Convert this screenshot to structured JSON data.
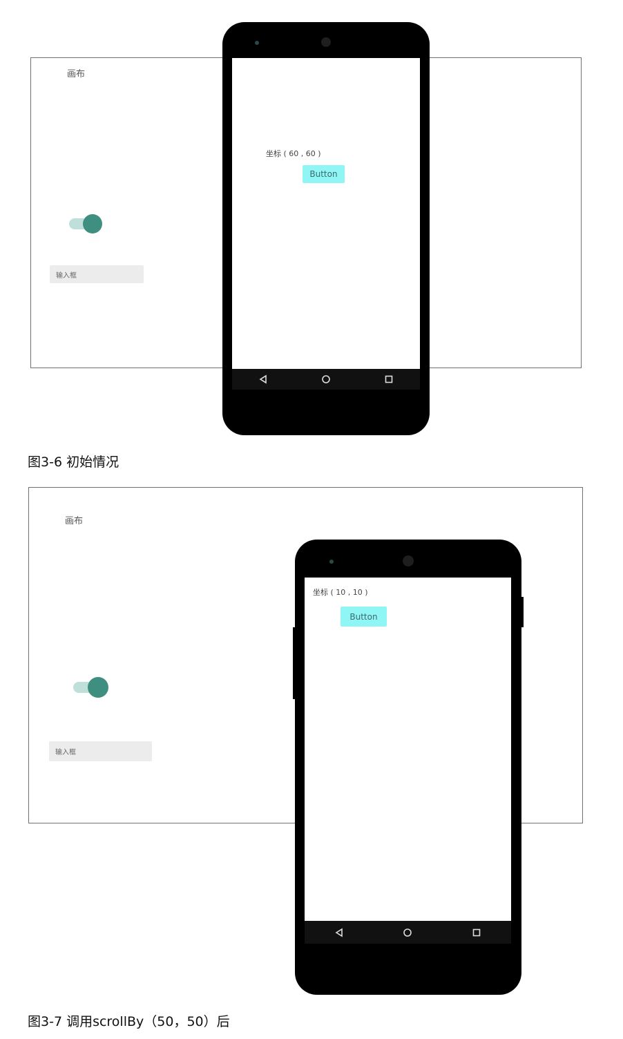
{
  "figures": [
    {
      "canvas_label": "画布",
      "input_placeholder": "输入框",
      "coordinate_text": "坐标 ( 60 , 60 )",
      "button_label": "Button",
      "caption": "图3-6  初始情况"
    },
    {
      "canvas_label": "画布",
      "input_placeholder": "输入框",
      "coordinate_text": "坐标 ( 10 , 10 )",
      "button_label": "Button",
      "caption": "图3-7  调用scrollBy（50，50）后"
    }
  ],
  "icons": {
    "nav": [
      "back-triangle-icon",
      "home-circle-icon",
      "recents-square-icon"
    ]
  },
  "colors": {
    "toggle_track": "#bfe0da",
    "toggle_thumb": "#3f8f80",
    "button_bg": "#8ff5f5",
    "input_bg": "#ececec",
    "phone_body": "#000000"
  }
}
